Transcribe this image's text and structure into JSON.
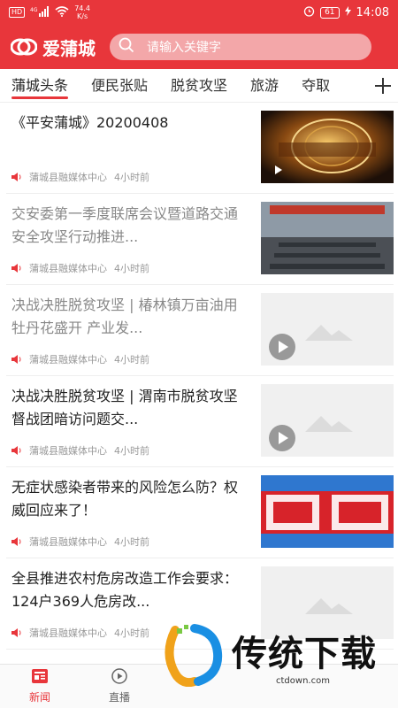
{
  "status_bar": {
    "hd": "HD",
    "sig": "4G",
    "speed_value": "74.4",
    "speed_unit": "K/s",
    "battery": "61",
    "time": "14:08"
  },
  "header": {
    "app_name": "爱蒲城",
    "search_placeholder": "请输入关键字"
  },
  "tabs": [
    {
      "label": "蒲城头条",
      "active": true
    },
    {
      "label": "便民张贴"
    },
    {
      "label": "脱贫攻坚"
    },
    {
      "label": "旅游"
    },
    {
      "label": "夺取"
    }
  ],
  "tab_add_icon": "plus-icon",
  "news": [
    {
      "title": "《平安蒲城》20200408",
      "source": "蒲城县融媒体中心",
      "time": "4小时前",
      "thumb": "video-ping-an"
    },
    {
      "title": "交安委第一季度联席会议暨道路交通安全攻坚行动推进...",
      "source": "蒲城县融媒体中心",
      "time": "4小时前",
      "thumb": "meeting-photo"
    },
    {
      "title": "决战决胜脱贫攻坚 | 椿林镇万亩油用牡丹花盛开 产业发...",
      "source": "蒲城县融媒体中心",
      "time": "4小时前",
      "thumb": "placeholder-video"
    },
    {
      "title": "决战决胜脱贫攻坚 | 渭南市脱贫攻坚督战团暗访问题交...",
      "source": "蒲城县融媒体中心",
      "time": "4小时前",
      "thumb": "placeholder-video"
    },
    {
      "title": "无症状感染者带来的风险怎么防？权威回应来了！",
      "source": "蒲城县融媒体中心",
      "time": "4小时前",
      "thumb": "wei-hui-banner"
    },
    {
      "title": "全县推进农村危房改造工作会要求：124户369人危房改...",
      "source": "蒲城县融媒体中心",
      "time": "4小时前",
      "thumb": "placeholder"
    }
  ],
  "bottom_nav": [
    {
      "label": "新闻",
      "icon": "news-icon",
      "active": true
    },
    {
      "label": "直播",
      "icon": "live-icon"
    }
  ],
  "watermark": {
    "title": "传统下载",
    "url": "ctdown.com"
  },
  "colors": {
    "brand_red": "#e8363b",
    "text_dark": "#222222",
    "text_grey": "#888888",
    "meta_grey": "#999999"
  }
}
